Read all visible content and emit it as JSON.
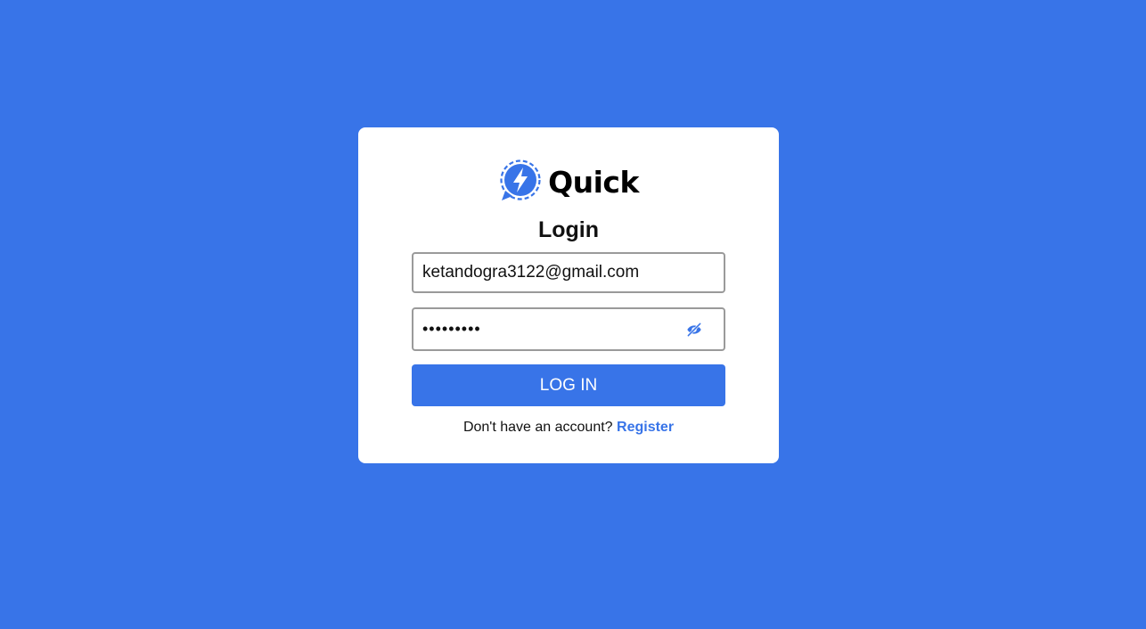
{
  "colors": {
    "background": "#3874E8",
    "accent": "#3874E8",
    "card": "#FFFFFF"
  },
  "brand": {
    "name": "Quick",
    "logo_icon": "lightning-chat-bubble-icon"
  },
  "form": {
    "title": "Login",
    "email_value": "ketandogra3122@gmail.com",
    "password_value": "•••••••••",
    "password_toggle_icon": "eye-slash-icon",
    "submit_label": "LOG IN"
  },
  "footer": {
    "prompt": "Don't have an account?",
    "register_label": "Register"
  }
}
